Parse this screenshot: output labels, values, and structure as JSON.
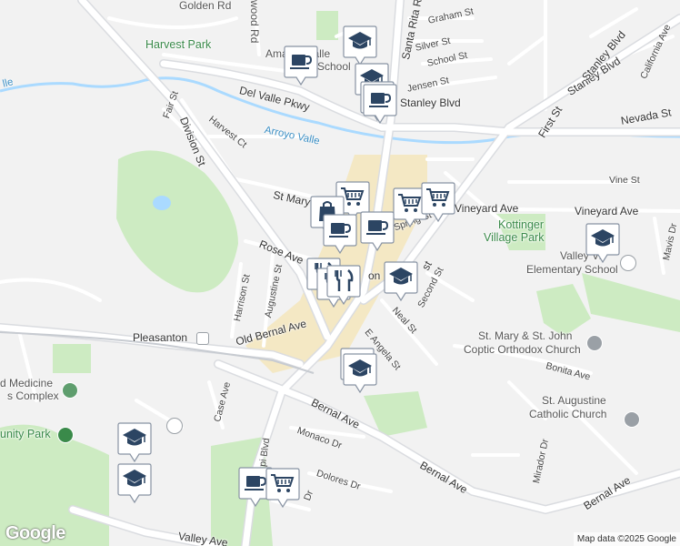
{
  "map": {
    "attribution": "Map data ©2025 Google",
    "logo": "Google",
    "colors": {
      "background": "#f2f2f2",
      "road": "#ffffff",
      "road_casing": "#d6d6d6",
      "highway": "#c8ccd2",
      "park": "#cdebc2",
      "water": "#aadaff",
      "downtown": "#f4e8c4",
      "marker_bg": "#ffffff",
      "marker_icon": "#2c4563"
    },
    "labels": {
      "golden_rd": "Golden Rd",
      "wood_rd": "wood Rd",
      "harvest_park": "Harvest Park",
      "amador_valley_school_1": "Amador Valle",
      "amador_valley_school_2": "School",
      "del_valle_pkwy": "Del Valle Pkwy",
      "santa_rita_rd": "Santa Rita Rd",
      "graham_st": "Graham St",
      "silver_st": "Silver St",
      "school_st": "School St",
      "jensen_st": "Jensen St",
      "stanley_blvd_1": "Stanley Blvd",
      "stanley_blvd_2": "Stanley Blvd",
      "stanley_blvd_3": "Stanley Blvd",
      "california_ave": "California Ave",
      "first_st": "First St",
      "nevada_st": "Nevada St",
      "fair_st": "Fair St",
      "division_st": "Division St",
      "harvest_ct": "Harvest Ct",
      "arroyo_valle": "Arroyo Valle",
      "arroyo_valle_left": "lle",
      "vine_st": "Vine St",
      "st_mary": "St Mary",
      "vineyard_ave_1": "Vineyard Ave",
      "vineyard_ave_2": "Vineyard Ave",
      "spring_st": "Spring St",
      "kottinger_1": "Kottinger",
      "kottinger_2": "Village Park",
      "valley_view_1": "Valley Vi",
      "valley_view_2": "Elementary School",
      "rose_ave": "Rose Ave",
      "second_st": "Second St",
      "harrison_st": "Harrison St",
      "augustine_st": "Augustine St",
      "neal_st": "Neal St",
      "mavis_dr": "Mavis Dr",
      "st_mary_church_1": "St. Mary & St. John",
      "st_mary_church_2": "Coptic Orthodox Church",
      "pleasanton": "Pleasanton",
      "old_bernal_ave": "Old Bernal Ave",
      "e_angela_st": "E Angela St",
      "bonita_ave": "Bonita Ave",
      "medicine_1": "d Medicine",
      "medicine_2": "s Complex",
      "st_augustine_1": "St. Augustine",
      "st_augustine_2": "Catholic Church",
      "case_ave": "Case Ave",
      "bernal_ave_1": "Bernal Ave",
      "bernal_ave_2": "Bernal Ave",
      "bernal_ave_3": "Bernal Ave",
      "unity_park": "unity Park",
      "monaco_dr": "Monaco Dr",
      "mirador_dr": "Mirador Dr",
      "pi_blvd": "pi Blvd",
      "dolores_dr": "Dolores Dr",
      "dr_small": "Dr",
      "valley_ave": "Valley Ave",
      "on_fragment": "on",
      "st_fragment": "st"
    },
    "markers": [
      {
        "type": "cafe-icon"
      },
      {
        "type": "school-icon"
      },
      {
        "type": "school-icon"
      },
      {
        "type": "cafe-icon"
      },
      {
        "type": "cafe-icon"
      },
      {
        "type": "shopping-cart-icon"
      },
      {
        "type": "shopping-bag-icon"
      },
      {
        "type": "shopping-cart-icon"
      },
      {
        "type": "shopping-cart-icon"
      },
      {
        "type": "cafe-icon"
      },
      {
        "type": "cafe-icon"
      },
      {
        "type": "restaurant-icon"
      },
      {
        "type": "restaurant-icon"
      },
      {
        "type": "restaurant-icon"
      },
      {
        "type": "school-icon"
      },
      {
        "type": "school-icon"
      },
      {
        "type": "school-icon"
      },
      {
        "type": "school-icon"
      },
      {
        "type": "school-icon"
      },
      {
        "type": "school-icon"
      },
      {
        "type": "cafe-icon"
      },
      {
        "type": "shopping-cart-icon"
      }
    ]
  }
}
